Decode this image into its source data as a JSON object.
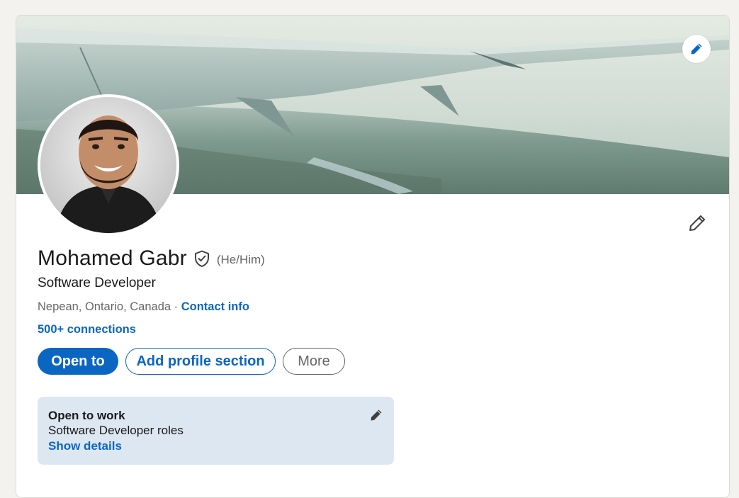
{
  "profile": {
    "name": "Mohamed Gabr",
    "pronouns": "(He/Him)",
    "headline": "Software Developer",
    "location": "Nepean, Ontario, Canada",
    "separator": " · ",
    "contact_info": "Contact info",
    "connections": "500+ connections"
  },
  "actions": {
    "open_to": "Open to",
    "add_profile_section": "Add profile section",
    "more": "More"
  },
  "open_to_work": {
    "title": "Open to work",
    "roles": "Software Developer roles",
    "details_link": "Show details"
  },
  "icons": {
    "banner_edit": "pencil-icon",
    "intro_edit": "pencil-icon",
    "verified": "shield-check-icon",
    "open_to_work_edit": "pencil-icon"
  },
  "colors": {
    "accent": "#0a66c2",
    "background": "#f3f2ef",
    "card": "#ffffff",
    "open_to_work_bg": "#dde7f1",
    "text_primary": "#191919",
    "text_secondary": "#666666"
  }
}
